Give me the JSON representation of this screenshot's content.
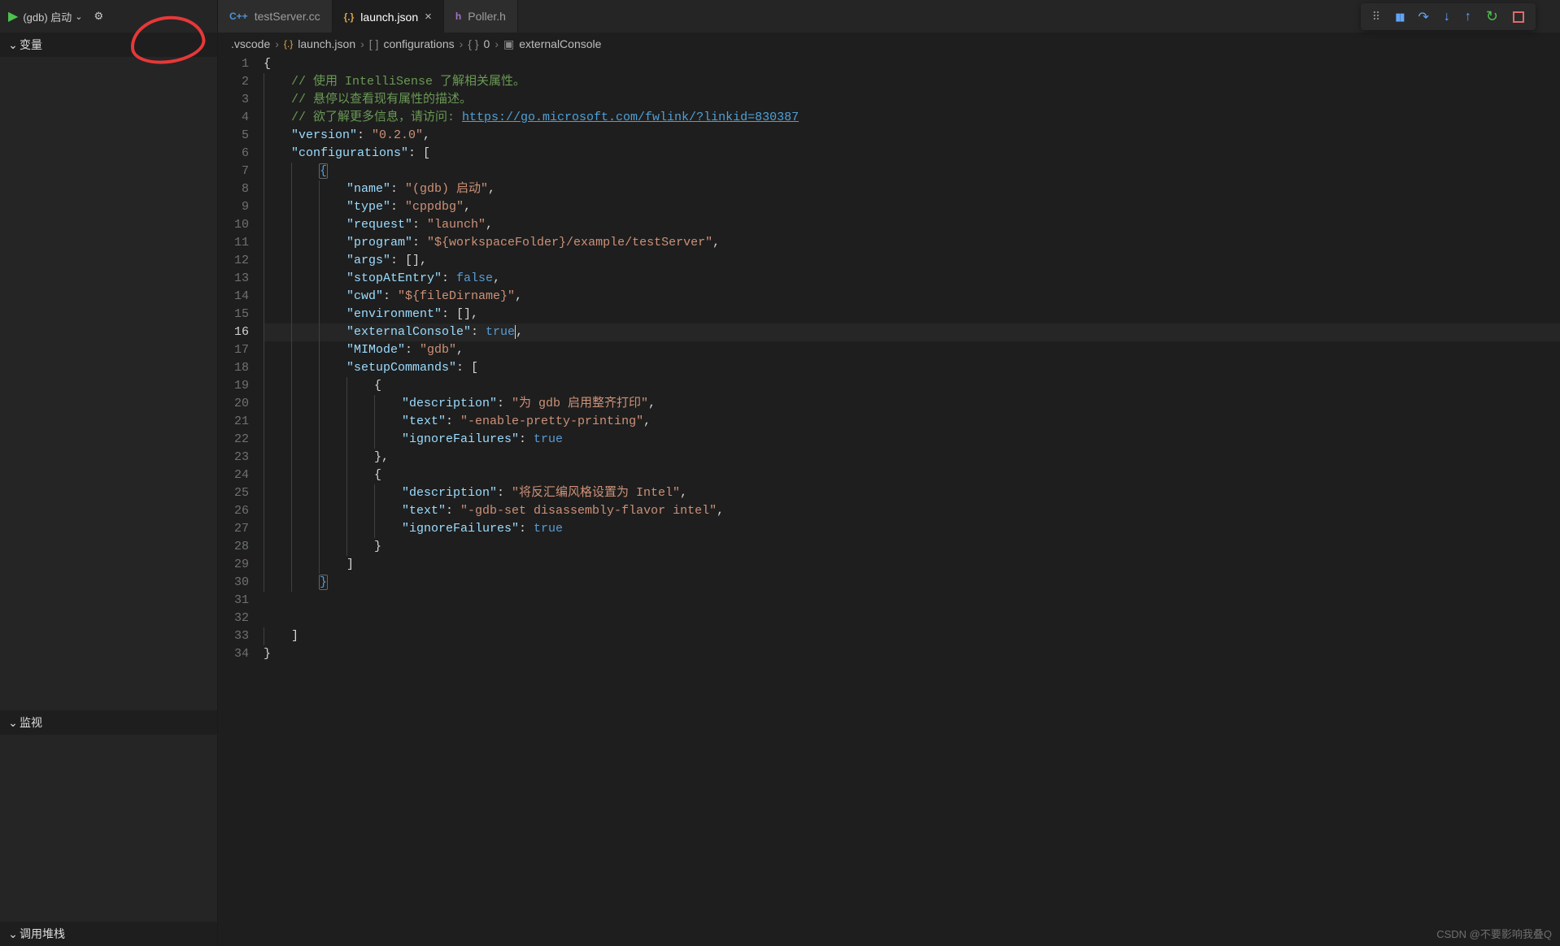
{
  "debugControl": {
    "config": "(gdb) 启动"
  },
  "sidebar": {
    "panels": [
      {
        "label": "变量"
      },
      {
        "label": "监视"
      },
      {
        "label": "调用堆栈"
      }
    ]
  },
  "tabs": [
    {
      "icon": "C++",
      "label": "testServer.cc",
      "active": false
    },
    {
      "icon": "{.}",
      "label": "launch.json",
      "active": true
    },
    {
      "icon": "h",
      "label": "Poller.h",
      "active": false
    }
  ],
  "breadcrumb": [
    {
      "icon": "",
      "text": ".vscode"
    },
    {
      "icon": "json",
      "text": "launch.json"
    },
    {
      "icon": "array",
      "text": "configurations"
    },
    {
      "icon": "obj",
      "text": "0"
    },
    {
      "icon": "sym",
      "text": "externalConsole"
    }
  ],
  "code": {
    "lines": [
      {
        "n": 1,
        "indent": 0,
        "parts": [
          [
            "brace",
            "{"
          ]
        ]
      },
      {
        "n": 2,
        "indent": 1,
        "parts": [
          [
            "comment",
            "// 使用 IntelliSense 了解相关属性。"
          ]
        ]
      },
      {
        "n": 3,
        "indent": 1,
        "parts": [
          [
            "comment",
            "// 悬停以查看现有属性的描述。"
          ]
        ]
      },
      {
        "n": 4,
        "indent": 1,
        "parts": [
          [
            "comment",
            "// 欲了解更多信息，请访问: "
          ],
          [
            "link",
            "https://go.microsoft.com/fwlink/?linkid=830387"
          ]
        ]
      },
      {
        "n": 5,
        "indent": 1,
        "parts": [
          [
            "key",
            "\"version\""
          ],
          [
            "punc",
            ": "
          ],
          [
            "string",
            "\"0.2.0\""
          ],
          [
            "punc",
            ","
          ]
        ]
      },
      {
        "n": 6,
        "indent": 1,
        "parts": [
          [
            "key",
            "\"configurations\""
          ],
          [
            "punc",
            ": ["
          ]
        ]
      },
      {
        "n": 7,
        "indent": 2,
        "parts": [
          [
            "brmatch",
            "{"
          ]
        ]
      },
      {
        "n": 8,
        "indent": 3,
        "parts": [
          [
            "key",
            "\"name\""
          ],
          [
            "punc",
            ": "
          ],
          [
            "string",
            "\"(gdb) 启动\""
          ],
          [
            "punc",
            ","
          ]
        ]
      },
      {
        "n": 9,
        "indent": 3,
        "parts": [
          [
            "key",
            "\"type\""
          ],
          [
            "punc",
            ": "
          ],
          [
            "string",
            "\"cppdbg\""
          ],
          [
            "punc",
            ","
          ]
        ]
      },
      {
        "n": 10,
        "indent": 3,
        "parts": [
          [
            "key",
            "\"request\""
          ],
          [
            "punc",
            ": "
          ],
          [
            "string",
            "\"launch\""
          ],
          [
            "punc",
            ","
          ]
        ]
      },
      {
        "n": 11,
        "indent": 3,
        "parts": [
          [
            "key",
            "\"program\""
          ],
          [
            "punc",
            ": "
          ],
          [
            "string",
            "\"${workspaceFolder}/example/testServer\""
          ],
          [
            "punc",
            ","
          ]
        ]
      },
      {
        "n": 12,
        "indent": 3,
        "parts": [
          [
            "key",
            "\"args\""
          ],
          [
            "punc",
            ": [],"
          ]
        ]
      },
      {
        "n": 13,
        "indent": 3,
        "parts": [
          [
            "key",
            "\"stopAtEntry\""
          ],
          [
            "punc",
            ": "
          ],
          [
            "bool",
            "false"
          ],
          [
            "punc",
            ","
          ]
        ]
      },
      {
        "n": 14,
        "indent": 3,
        "parts": [
          [
            "key",
            "\"cwd\""
          ],
          [
            "punc",
            ": "
          ],
          [
            "string",
            "\"${fileDirname}\""
          ],
          [
            "punc",
            ","
          ]
        ]
      },
      {
        "n": 15,
        "indent": 3,
        "parts": [
          [
            "key",
            "\"environment\""
          ],
          [
            "punc",
            ": [],"
          ]
        ]
      },
      {
        "n": 16,
        "indent": 3,
        "cur": true,
        "parts": [
          [
            "key",
            "\"externalConsole\""
          ],
          [
            "punc",
            ": "
          ],
          [
            "bool",
            "true"
          ],
          [
            "caret",
            ""
          ],
          [
            "punc",
            ","
          ]
        ]
      },
      {
        "n": 17,
        "indent": 3,
        "parts": [
          [
            "key",
            "\"MIMode\""
          ],
          [
            "punc",
            ": "
          ],
          [
            "string",
            "\"gdb\""
          ],
          [
            "punc",
            ","
          ]
        ]
      },
      {
        "n": 18,
        "indent": 3,
        "parts": [
          [
            "key",
            "\"setupCommands\""
          ],
          [
            "punc",
            ": ["
          ]
        ]
      },
      {
        "n": 19,
        "indent": 4,
        "parts": [
          [
            "brace",
            "{"
          ]
        ]
      },
      {
        "n": 20,
        "indent": 5,
        "parts": [
          [
            "key",
            "\"description\""
          ],
          [
            "punc",
            ": "
          ],
          [
            "string",
            "\"为 gdb 启用整齐打印\""
          ],
          [
            "punc",
            ","
          ]
        ]
      },
      {
        "n": 21,
        "indent": 5,
        "parts": [
          [
            "key",
            "\"text\""
          ],
          [
            "punc",
            ": "
          ],
          [
            "string",
            "\"-enable-pretty-printing\""
          ],
          [
            "punc",
            ","
          ]
        ]
      },
      {
        "n": 22,
        "indent": 5,
        "parts": [
          [
            "key",
            "\"ignoreFailures\""
          ],
          [
            "punc",
            ": "
          ],
          [
            "bool",
            "true"
          ]
        ]
      },
      {
        "n": 23,
        "indent": 4,
        "parts": [
          [
            "brace",
            "},"
          ]
        ]
      },
      {
        "n": 24,
        "indent": 4,
        "parts": [
          [
            "brace",
            "{"
          ]
        ]
      },
      {
        "n": 25,
        "indent": 5,
        "parts": [
          [
            "key",
            "\"description\""
          ],
          [
            "punc",
            ": "
          ],
          [
            "string",
            "\"将反汇编风格设置为 Intel\""
          ],
          [
            "punc",
            ","
          ]
        ]
      },
      {
        "n": 26,
        "indent": 5,
        "parts": [
          [
            "key",
            "\"text\""
          ],
          [
            "punc",
            ": "
          ],
          [
            "string",
            "\"-gdb-set disassembly-flavor intel\""
          ],
          [
            "punc",
            ","
          ]
        ]
      },
      {
        "n": 27,
        "indent": 5,
        "parts": [
          [
            "key",
            "\"ignoreFailures\""
          ],
          [
            "punc",
            ": "
          ],
          [
            "bool",
            "true"
          ]
        ]
      },
      {
        "n": 28,
        "indent": 4,
        "parts": [
          [
            "brace",
            "}"
          ]
        ]
      },
      {
        "n": 29,
        "indent": 3,
        "parts": [
          [
            "brace",
            "]"
          ]
        ]
      },
      {
        "n": 30,
        "indent": 2,
        "parts": [
          [
            "brmatch",
            "}"
          ]
        ]
      },
      {
        "n": 31,
        "indent": 0,
        "parts": []
      },
      {
        "n": 32,
        "indent": 0,
        "parts": []
      },
      {
        "n": 33,
        "indent": 1,
        "parts": [
          [
            "brace",
            "]"
          ]
        ]
      },
      {
        "n": 34,
        "indent": 0,
        "parts": [
          [
            "brace",
            "}"
          ]
        ]
      }
    ]
  },
  "watermark": "CSDN @不要影响我叠Q"
}
